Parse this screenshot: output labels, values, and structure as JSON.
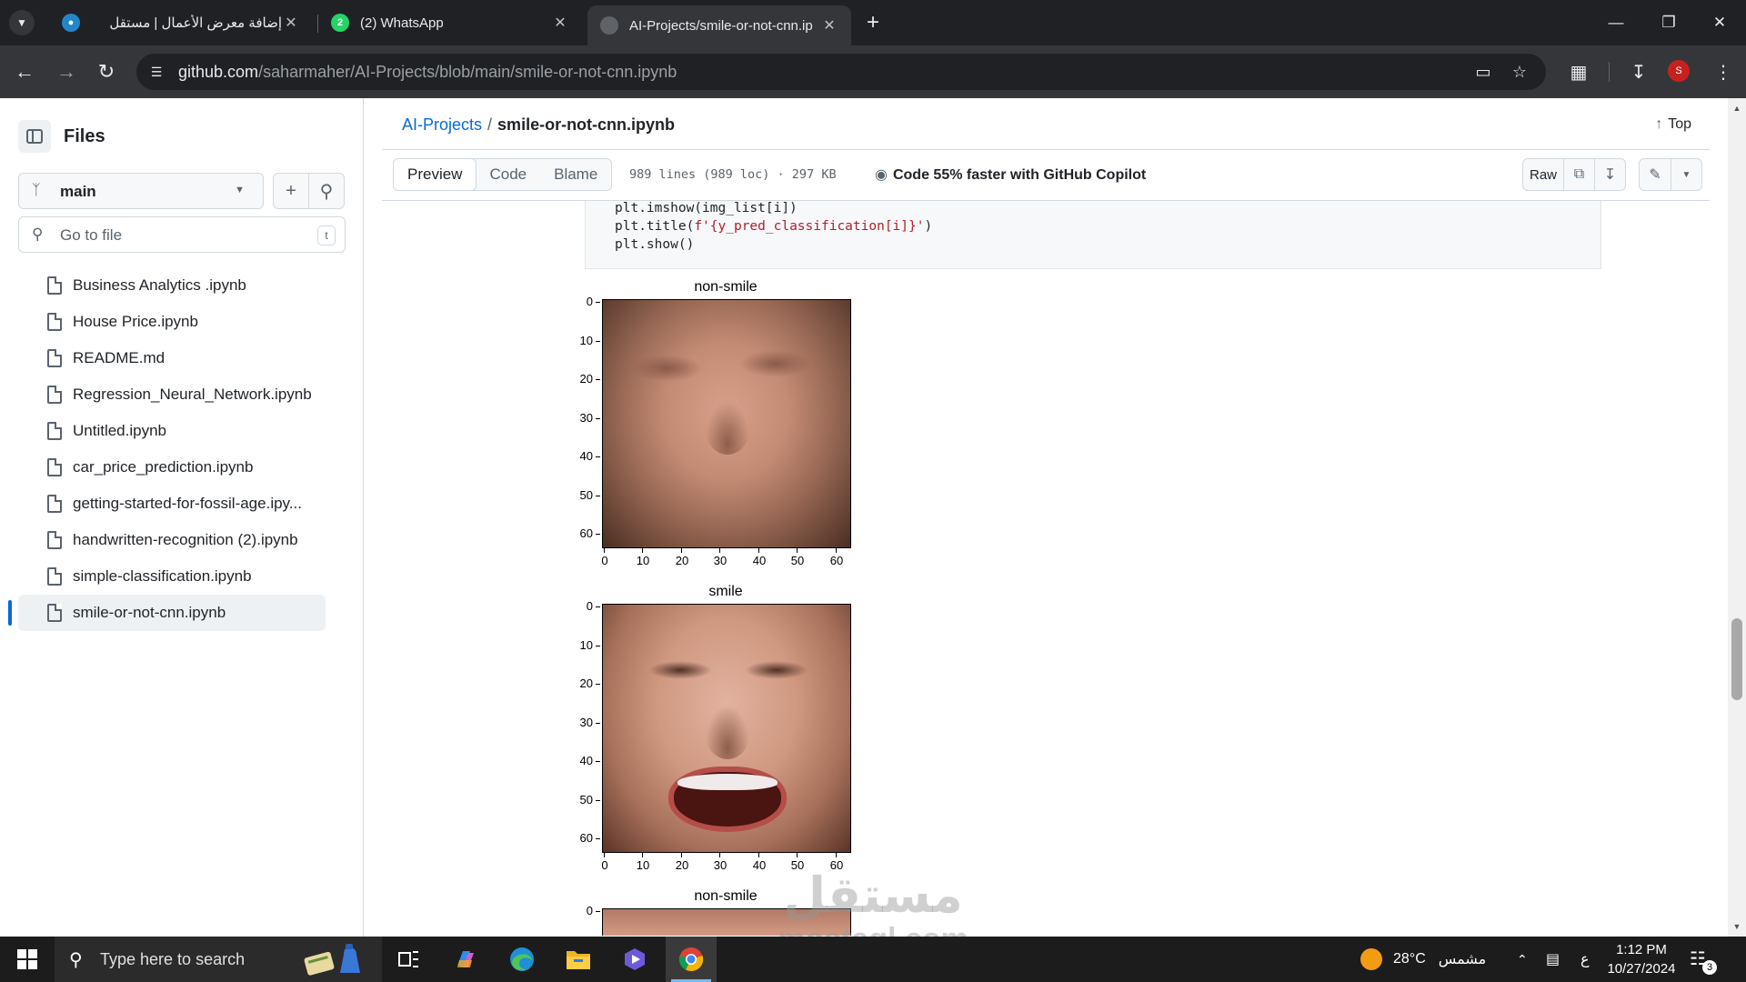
{
  "browser": {
    "tabs": [
      {
        "title": "إضافة معرض الأعمال | مستقل",
        "icon": "mostaql-icon",
        "color": "#2386c8"
      },
      {
        "title": "(2) WhatsApp",
        "icon": "whatsapp-icon",
        "color": "#25d366",
        "badge": "2"
      },
      {
        "title": "AI-Projects/smile-or-not-cnn.ip",
        "icon": "github-icon",
        "color": "#5f6368",
        "active": true
      }
    ],
    "url_host": "github.com",
    "url_path": "/saharmaher/AI-Projects/blob/main/smile-or-not-cnn.ipynb",
    "profile_initial": "S"
  },
  "sidebar": {
    "title": "Files",
    "branch": "main",
    "search_placeholder": "Go to file",
    "search_shortcut": "t",
    "files": [
      "Business Analytics .ipynb",
      "House Price.ipynb",
      "README.md",
      "Regression_Neural_Network.ipynb",
      "Untitled.ipynb",
      "car_price_prediction.ipynb",
      "getting-started-for-fossil-age.ipy...",
      "handwritten-recognition (2).ipynb",
      "simple-classification.ipynb",
      "smile-or-not-cnn.ipynb"
    ],
    "selected_index": 9
  },
  "header": {
    "repo": "AI-Projects",
    "separator": "/",
    "file": "smile-or-not-cnn.ipynb",
    "top_label": "Top",
    "tabs": [
      "Preview",
      "Code",
      "Blame"
    ],
    "active_tab": "Preview",
    "meta": "989 lines (989 loc) · 297 KB",
    "copilot": "Code 55% faster with GitHub Copilot",
    "raw_label": "Raw"
  },
  "code": {
    "lines": [
      {
        "pre": "plt.imshow(img_list[i])",
        "str": "",
        "post": ""
      },
      {
        "pre": "plt.title(",
        "str": "f'{y_pred_classification[i]}'",
        "post": ")"
      },
      {
        "pre": "plt.show()",
        "str": "",
        "post": ""
      }
    ]
  },
  "plots": [
    {
      "title": "non-smile"
    },
    {
      "title": "smile"
    },
    {
      "title": "non-smile"
    }
  ],
  "axes": {
    "yticks": [
      "0",
      "10",
      "20",
      "30",
      "40",
      "50",
      "60"
    ],
    "xticks": [
      "0",
      "10",
      "20",
      "30",
      "40",
      "50",
      "60"
    ]
  },
  "watermark": {
    "arabic": "مستقل",
    "latin": "mostaql.com"
  },
  "taskbar": {
    "search_placeholder": "Type here to search",
    "weather_temp": "28°C",
    "weather_text": "مشمس",
    "lang": "ع",
    "time": "1:12 PM",
    "date": "10/27/2024",
    "notifications": "3"
  }
}
